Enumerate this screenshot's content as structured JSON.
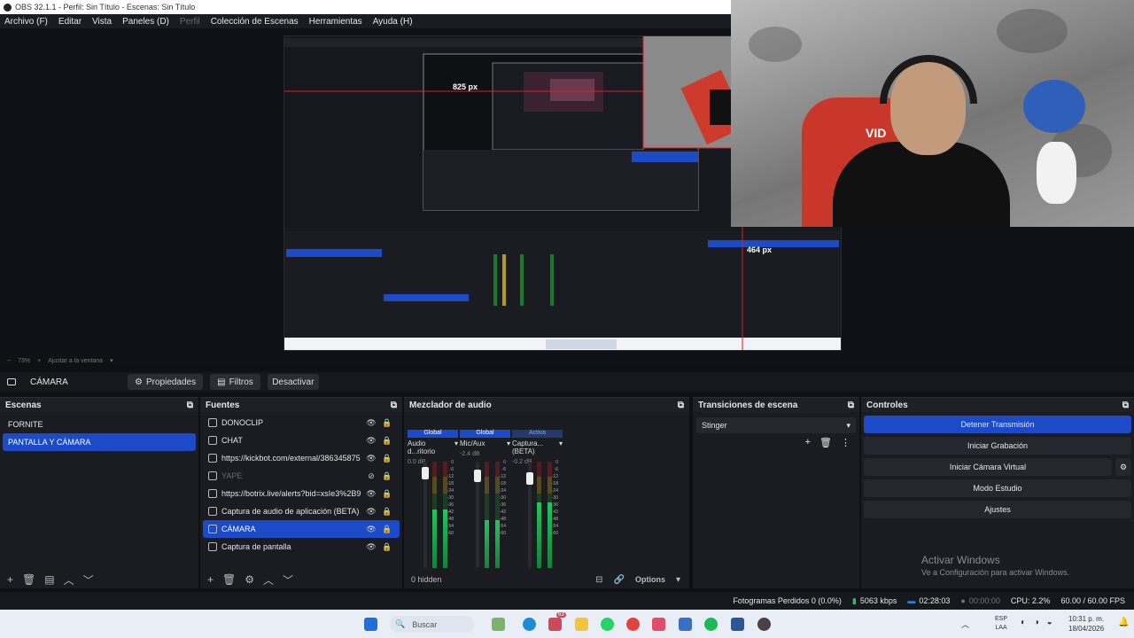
{
  "window": {
    "title": "OBS 32.1.1 - Perfil: Sin Título - Escenas: Sin Título"
  },
  "menu": [
    "Archivo (F)",
    "Editar",
    "Vista",
    "Paneles (D)",
    "Perfil",
    "Colección de Escenas",
    "Herramientas",
    "Ayuda (H)"
  ],
  "preview": {
    "measure_top": "825 px",
    "measure_right": "464 px",
    "zoom": "73%",
    "fit_label": "Ajustar a la ventana",
    "webcam_shirt_text": "VID"
  },
  "source_toolbar": {
    "source_name": "CÁMARA",
    "properties": "Propiedades",
    "filters": "Filtros",
    "deactivate": "Desactivar"
  },
  "scenes": {
    "title": "Escenas",
    "items": [
      "FORNITE",
      "PANTALLA Y CÁMARA"
    ],
    "selected": 1
  },
  "sources": {
    "title": "Fuentes",
    "items": [
      {
        "label": "DONOCLIP",
        "icon": "browser-icon",
        "visible": true
      },
      {
        "label": "CHAT",
        "icon": "browser-icon",
        "visible": true
      },
      {
        "label": "https://kickbot.com/external/386345875",
        "icon": "browser-icon",
        "visible": true
      },
      {
        "label": "YAPE",
        "icon": "browser-icon",
        "visible": false
      },
      {
        "label": "https://botrix.live/alerts?bid=xsIe3%2B9",
        "icon": "browser-icon",
        "visible": true
      },
      {
        "label": "Captura de audio de aplicación (BETA)",
        "icon": "app-audio-icon",
        "visible": true
      },
      {
        "label": "CÁMARA",
        "icon": "camera-icon",
        "visible": true
      },
      {
        "label": "Captura de pantalla",
        "icon": "monitor-icon",
        "visible": true
      }
    ],
    "selected": 6
  },
  "mixer": {
    "title": "Mezclador de audio",
    "hidden_label": "0 hidden",
    "options_label": "Options",
    "channels": [
      {
        "tag": "Global",
        "name": "Audio d...ritorio",
        "db": "0.0 dB",
        "level": 0.55
      },
      {
        "tag": "Global",
        "name": "Mic/Aux",
        "db": "-2.4 dB",
        "level": 0.45
      },
      {
        "tag": "Activa",
        "name": "Captura... (BETA)",
        "db": "-0.2 dB",
        "level": 0.62
      }
    ],
    "ticks": [
      "0",
      "-6",
      "-12",
      "-18",
      "-24",
      "-30",
      "-36",
      "-42",
      "-48",
      "-54",
      "-60"
    ]
  },
  "transitions": {
    "title": "Transiciones de escena",
    "selected": "Stinger"
  },
  "controls": {
    "title": "Controles",
    "stop_stream": "Detener Transmisión",
    "start_recording": "Iniciar Grabación",
    "start_vcam": "Iniciar Cámara Virtual",
    "studio_mode": "Modo Estudio",
    "settings": "Ajustes"
  },
  "watermark": {
    "title": "Activar Windows",
    "subtitle": "Ve a Configuración para activar Windows."
  },
  "status": {
    "dropped_frames": "Fotogramas Perdidos 0 (0.0%)",
    "bitrate": "5063 kbps",
    "stream_time": "02:28:03",
    "rec_time": "00:00:00",
    "cpu": "CPU: 2.2%",
    "fps": "60.00 / 60.00 FPS"
  },
  "taskbar": {
    "search_placeholder": "Buscar",
    "badge": "63",
    "lang_top": "ESP",
    "lang_bottom": "LAA",
    "time": "10:31 p. m.",
    "date": "18/04/2026"
  },
  "colors": {
    "accent": "#1d4bc8",
    "background": "#1b1c22",
    "stream_guide": "#e11d1d"
  }
}
